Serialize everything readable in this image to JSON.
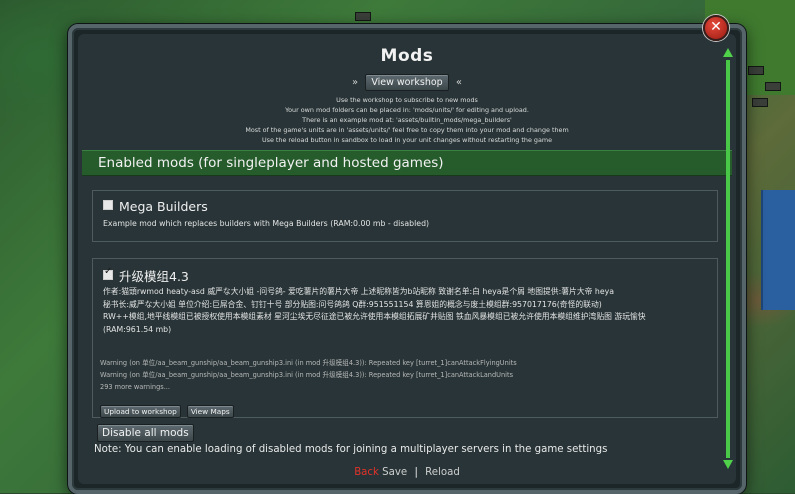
{
  "dialog": {
    "title": "Mods",
    "close_glyph": "✕",
    "workshop_arrows_left": "»",
    "workshop_arrows_right": "«",
    "workshop_button": "View workshop",
    "info_lines": [
      "Use the workshop to subscribe to new mods",
      "Your own mod folders can be placed in: 'mods/units/' for editing and upload.",
      "There is an example mod at: 'assets/builtin_mods/mega_builders'",
      "Most of the game's units are in 'assets/units/' feel free to copy them into your mod and change them",
      "Use the reload button in sandbox to load in your unit changes without restarting the game"
    ],
    "section_header": "Enabled mods (for singleplayer and hosted games)"
  },
  "mods": [
    {
      "title": "Mega Builders",
      "checked": false,
      "description": [
        "Example mod which replaces builders with Mega Builders (RAM:0.00 mb - disabled)"
      ]
    },
    {
      "title": "升级模组4.3",
      "checked": true,
      "description": [
        "作者:猫頭rwmod heaty-asd 威严な大小姐 -问号鸽- 爱吃薯片的薯片大帝 上述昵称皆为b站昵称 致谢名单:白 heya是个屑 地图提供:薯片大帝 heya",
        "秘书长:威严な大小姐 单位介绍:巨屌合金、钉钉十号 部分贴图:问号鸽鸽 Q群:951551154 算恩姐的概念与废土模组群:957017176(奇怪的联动)",
        "RW++模组,地平线模组已被授权使用本模组素材 星河尘埃无尽征途已被允许使用本模组拓展矿井贴图 铁血风暴模组已被允许使用本模组维护湾贴图 游玩愉快",
        "(RAM:961.54 mb)"
      ],
      "warnings": [
        "Warning (on 单位/aa_beam_gunship/aa_beam_gunship3.ini (in mod 升级模组4.3)): Repeated key [turret_1]canAttackFlyingUnits",
        "Warning (on 单位/aa_beam_gunship/aa_beam_gunship3.ini (in mod 升级模组4.3)): Repeated key [turret_1]canAttackLandUnits",
        "293 more warnings..."
      ],
      "buttons": [
        "Upload to workshop",
        "View Maps"
      ]
    }
  ],
  "footer": {
    "disable_all_button": "Disable all mods",
    "note": "Note: You can enable loading of disabled mods for joining a multiplayer servers in the game settings",
    "back_label": "Back",
    "save_label": "Save",
    "separator": "|",
    "reload_label": "Reload"
  },
  "colors": {
    "accent_green": "#265c2c",
    "scrollbar_green": "#49c847",
    "back_red": "#e0332a",
    "close_red": "#c8301f"
  }
}
